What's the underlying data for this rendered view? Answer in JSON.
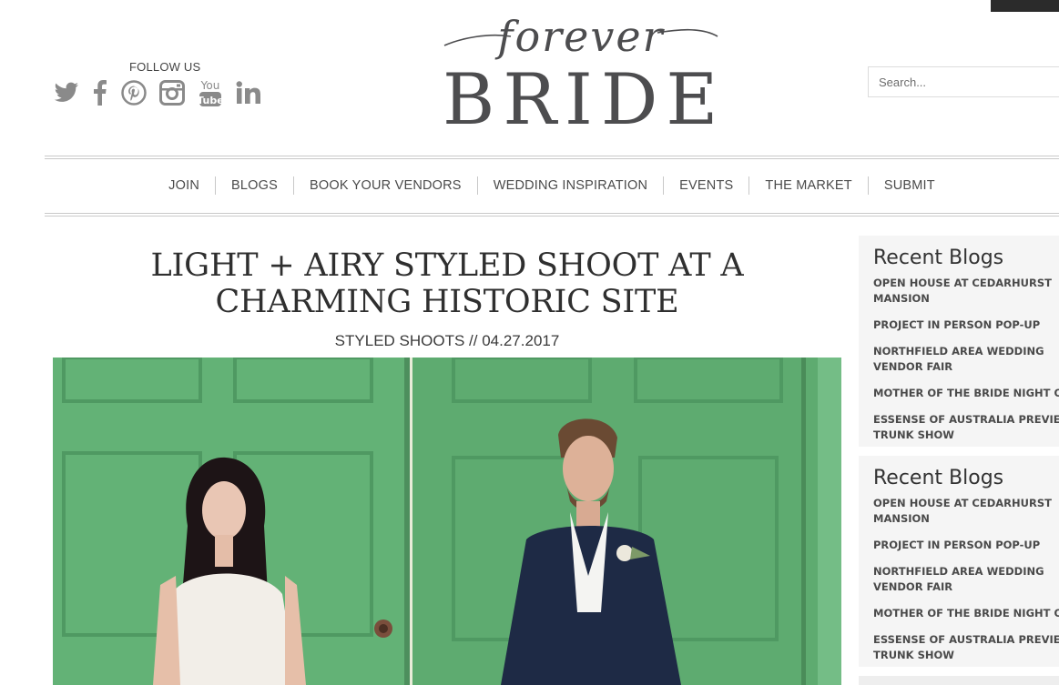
{
  "header": {
    "follow_label": "FOLLOW US",
    "social_icons": [
      "twitter-icon",
      "facebook-icon",
      "pinterest-icon",
      "instagram-icon",
      "youtube-icon",
      "linkedin-icon"
    ],
    "logo_script": "forever",
    "logo_main": "BRIDE",
    "search_placeholder": "Search..."
  },
  "nav": {
    "items": [
      "JOIN",
      "BLOGS",
      "BOOK YOUR VENDORS",
      "WEDDING INSPIRATION",
      "EVENTS",
      "THE MARKET",
      "SUBMIT"
    ]
  },
  "article": {
    "title": "LIGHT + AIRY STYLED SHOOT AT A CHARMING HISTORIC SITE",
    "category": "STYLED SHOOTS",
    "separator": " // ",
    "date": "04.27.2017"
  },
  "sidebar": {
    "widgets": [
      {
        "title": "Recent Blogs",
        "items": [
          "OPEN HOUSE AT CEDARHURST MANSION",
          "PROJECT IN PERSON POP-UP",
          "NORTHFIELD AREA WEDDING VENDOR FAIR",
          "MOTHER OF THE BRIDE NIGHT OUT",
          "ESSENSE OF AUSTRALIA PREVIEW TRUNK SHOW"
        ]
      },
      {
        "title": "Recent Blogs",
        "items": [
          "OPEN HOUSE AT CEDARHURST MANSION",
          "PROJECT IN PERSON POP-UP",
          "NORTHFIELD AREA WEDDING VENDOR FAIR",
          "MOTHER OF THE BRIDE NIGHT OUT",
          "ESSENSE OF AUSTRALIA PREVIEW TRUNK SHOW"
        ]
      }
    ]
  },
  "colors": {
    "door_green": "#5fae72",
    "text_dark": "#3c3c3c",
    "sidebar_bg": "#f5f5f5"
  }
}
